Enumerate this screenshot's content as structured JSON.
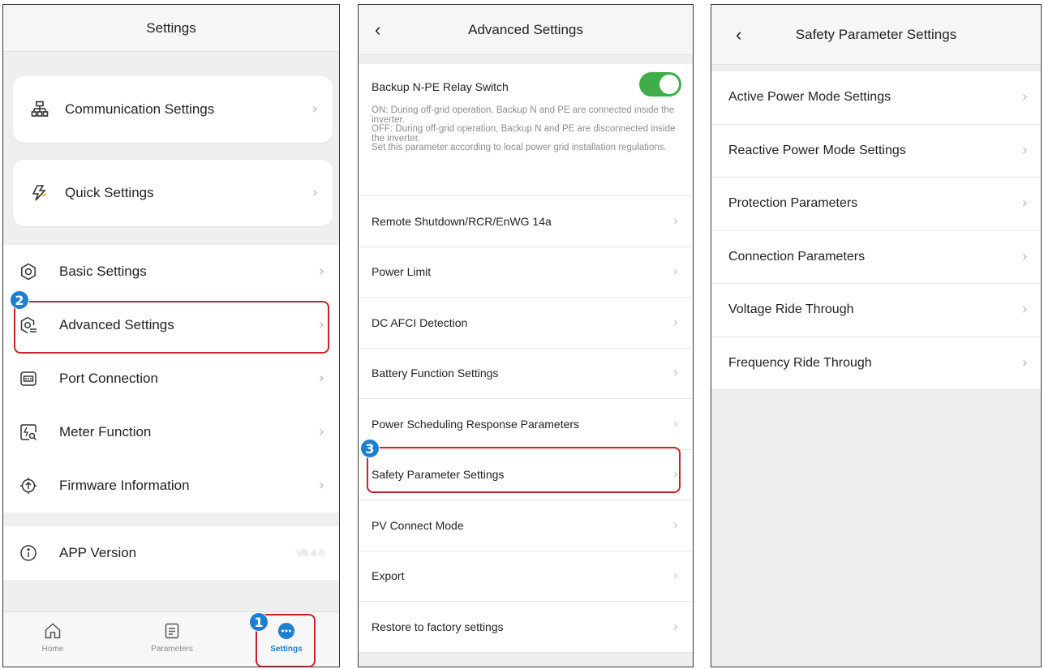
{
  "screen1": {
    "title": "Settings",
    "cards": [
      {
        "label": "Communication Settings",
        "icon": "network-icon"
      },
      {
        "label": "Quick Settings",
        "icon": "lightning-icon"
      }
    ],
    "items": [
      {
        "label": "Basic Settings",
        "icon": "gear-icon"
      },
      {
        "label": "Advanced Settings",
        "icon": "advanced-gear-icon"
      },
      {
        "label": "Port Connection",
        "icon": "port-icon"
      },
      {
        "label": "Meter Function",
        "icon": "meter-icon"
      },
      {
        "label": "Firmware Information",
        "icon": "firmware-icon"
      }
    ],
    "app_version": {
      "label": "APP Version",
      "value": "V6.4.0"
    },
    "tabs": [
      {
        "label": "Home",
        "icon": "home-icon"
      },
      {
        "label": "Parameters",
        "icon": "document-icon"
      },
      {
        "label": "Settings",
        "icon": "more-icon"
      }
    ]
  },
  "screen2": {
    "title": "Advanced Settings",
    "relay": {
      "title": "Backup N-PE Relay Switch",
      "enabled": true,
      "desc1": "ON: During off-grid operation, Backup N and PE are connected inside the inverter.",
      "desc2": "OFF: During off-grid operation, Backup N and PE are disconnected inside the inverter.",
      "desc3": "Set this parameter according to local power grid installation regulations."
    },
    "items": [
      "Remote Shutdown/RCR/EnWG 14a",
      "Power Limit",
      "DC AFCI Detection",
      "Battery Function Settings",
      "Power Scheduling Response Parameters",
      "Safety Parameter Settings",
      "PV Connect Mode",
      "Export",
      "Restore to factory settings"
    ]
  },
  "screen3": {
    "title": "Safety Parameter Settings",
    "items": [
      "Active Power Mode Settings",
      "Reactive Power Mode Settings",
      "Protection Parameters",
      "Connection Parameters",
      "Voltage Ride Through",
      "Frequency Ride Through"
    ]
  },
  "steps": {
    "one": "1",
    "two": "2",
    "three": "3"
  },
  "colors": {
    "accent_blue": "#1f7fcf",
    "highlight_red": "#c8232c",
    "toggle_green": "#3fae49"
  }
}
